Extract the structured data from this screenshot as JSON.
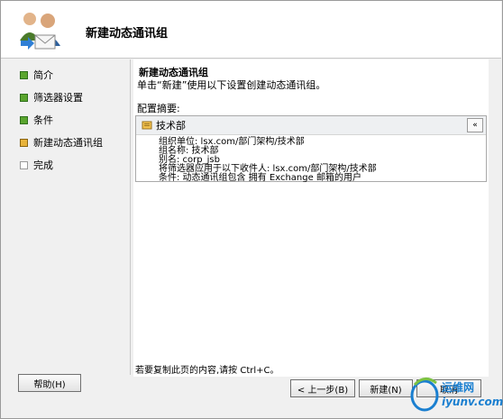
{
  "wizard": {
    "title": "新建动态通讯组"
  },
  "nav": {
    "items": [
      {
        "label": "简介",
        "state": "done"
      },
      {
        "label": "筛选器设置",
        "state": "done"
      },
      {
        "label": "条件",
        "state": "done"
      },
      {
        "label": "新建动态通讯组",
        "state": "current"
      },
      {
        "label": "完成",
        "state": "pending"
      }
    ]
  },
  "page": {
    "title": "新建动态通讯组",
    "description": "单击“新建”使用以下设置创建动态通讯组。",
    "summary_label": "配置摘要:",
    "summary": {
      "name": "技术部",
      "collapse_icon": "«",
      "lines": [
        "组织单位: lsx.com/部门架构/技术部",
        "组名称: 技术部",
        "别名: corp_jsb",
        "将筛选器应用于以下收件人: lsx.com/部门架构/技术部",
        "条件: 动态通讯组包含 拥有 Exchange 邮箱的用户"
      ]
    },
    "copy_hint": "若要复制此页的内容,请按 Ctrl+C。"
  },
  "buttons": {
    "help": "帮助(H)",
    "back": "< 上一步(B)",
    "new": "新建(N)",
    "cancel": "取消"
  },
  "watermark": {
    "line1": "运维网",
    "line2": "iyunv.com"
  },
  "colors": {
    "done": "#5aa52e",
    "current": "#e8b33a",
    "watermark": "#1a7fd0"
  }
}
